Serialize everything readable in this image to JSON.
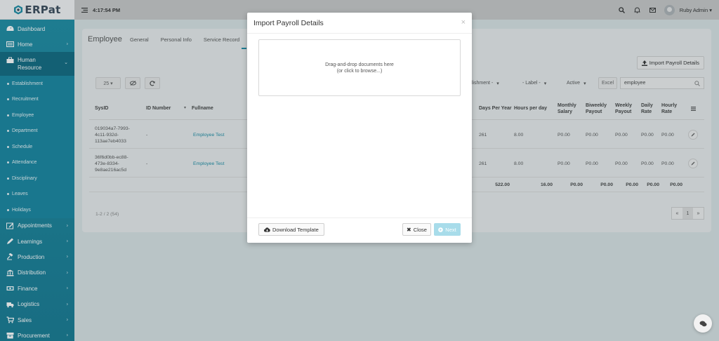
{
  "app": {
    "logo_text": "ERPat"
  },
  "topbar": {
    "time": "4:17:54 PM",
    "user_name": "Ruby Admin ▾"
  },
  "sidebar": {
    "items_top": [
      {
        "label": "Dashboard",
        "icon": "dashboard-icon"
      },
      {
        "label": "Home",
        "icon": "home-icon"
      }
    ],
    "active": {
      "label_line1": "Human",
      "label_line2": "Resource",
      "icon": "briefcase-icon"
    },
    "subitems": [
      "Establishment",
      "Recruitment",
      "Employee",
      "Department",
      "Schedule",
      "Attendance",
      "Disciplinary",
      "Leaves",
      "Holidays"
    ],
    "items_bottom": [
      {
        "label": "Appointments",
        "icon": "calendar-edit-icon"
      },
      {
        "label": "Learnings",
        "icon": "pencil-icon"
      },
      {
        "label": "Production",
        "icon": "gavel-icon"
      },
      {
        "label": "Distribution",
        "icon": "bank-icon"
      },
      {
        "label": "Finance",
        "icon": "money-icon"
      },
      {
        "label": "Logistics",
        "icon": "truck-icon"
      },
      {
        "label": "Sales",
        "icon": "cart-icon"
      },
      {
        "label": "Procurement",
        "icon": "box-icon"
      }
    ]
  },
  "page": {
    "title": "Employee",
    "tabs": [
      "General",
      "Personal Info",
      "Service Record"
    ],
    "import_button": "Import Payroll Details",
    "page_size": "25 ▾",
    "filters": {
      "establishment": "blishment -",
      "label": "- Label -",
      "status": "Active",
      "excel": "Excel"
    },
    "search_value": "employee",
    "headers": {
      "sysid": "SysID",
      "id_number": "ID Number",
      "fullname": "Fullname",
      "days_per_year": "Days Per Year",
      "hours_per_day": "Hours per day",
      "monthly_salary": "Monthly Salary",
      "biweekly_payout": "Biweekly Payout",
      "weekly_payout": "Weekly Payout",
      "daily_rate": "Daily Rate",
      "hourly_rate": "Hourly Rate"
    },
    "rows": [
      {
        "sysid": "019034a7-7993-4c11-932d-113ae7eb4033",
        "id_number": "-",
        "fullname": "Employee Test",
        "days": "261",
        "hours": "8.00",
        "monthly": "P0.00",
        "biweekly": "P0.00",
        "weekly": "P0.00",
        "daily": "P0.00",
        "hourly": "P0.00"
      },
      {
        "sysid": "36f6d0bb-ec88-473e-8334-9e8ae216ac5d",
        "id_number": "-",
        "fullname": "Employee Test",
        "days": "261",
        "hours": "8.00",
        "monthly": "P0.00",
        "biweekly": "P0.00",
        "weekly": "P0.00",
        "daily": "P0.00",
        "hourly": "P0.00"
      }
    ],
    "totals": {
      "days": "522.00",
      "hours": "16.00",
      "monthly": "P0.00",
      "biweekly": "P0.00",
      "weekly": "P0.00",
      "daily": "P0.00",
      "hourly": "P0.00"
    },
    "pagination_text": "1-2 / 2 (54)",
    "pager": {
      "prev": "«",
      "current": "1",
      "next": "»"
    }
  },
  "modal": {
    "title": "Import Payroll Details",
    "close_glyph": "×",
    "dropzone_line1": "Drag-and-drop documents here",
    "dropzone_line2": "(or click to browse...)",
    "download_template": "Download Template",
    "close_button": "Close",
    "next_button": "Next"
  },
  "colors": {
    "brand": "#1d8ca4",
    "sidebar_active": "#0f6a80",
    "next_disabled": "#a8dcea"
  }
}
